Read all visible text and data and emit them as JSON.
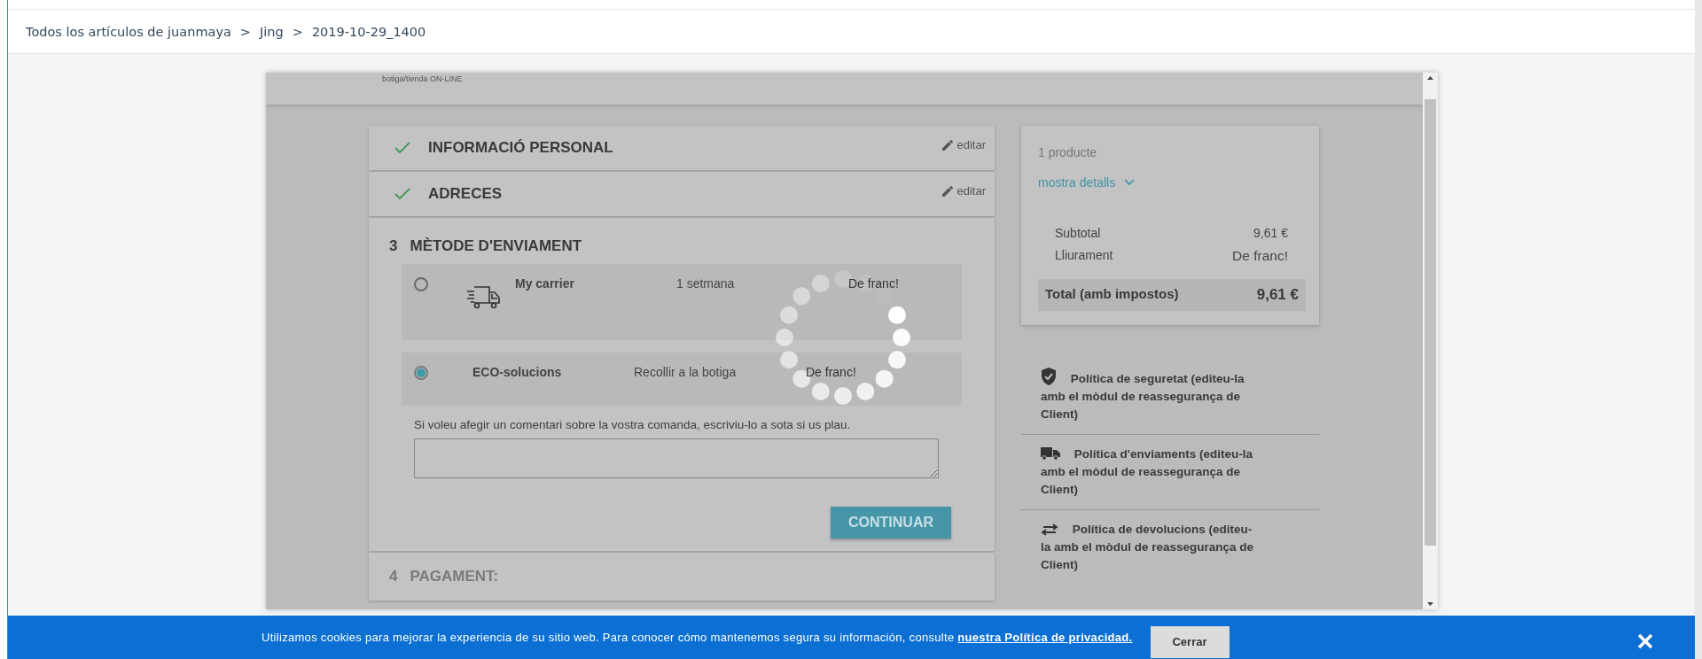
{
  "breadcrumb": [
    {
      "label": "Todos los artículos de juanmaya",
      "separator": ">"
    },
    {
      "label": "Jing",
      "separator": ">"
    },
    {
      "label": "2019-10-29_1400"
    }
  ],
  "shop_header": {
    "logo_tagline": "botiga/tienda ON-LINE"
  },
  "completed_steps": [
    {
      "title": "INFORMACIÓ PERSONAL",
      "edit": "editar"
    },
    {
      "title": "ADRECES",
      "edit": "editar"
    }
  ],
  "current_step": {
    "number": "3",
    "title": "MÈTODE D'ENVIAMENT",
    "carriers": [
      {
        "kind": "with-logo",
        "name": "My carrier",
        "delay": "1 setmana",
        "price": "De franc!",
        "selected": false
      },
      {
        "kind": "plain",
        "name": "ECO-solucions",
        "delay": "Recollir a la botiga",
        "price": "De franc!",
        "selected": true
      }
    ],
    "comment_label": "Si voleu afegir un comentari sobre la vostra comanda, escriviu-lo a sota si us plau.",
    "continue_button": "CONTINUAR"
  },
  "next_step": {
    "number": "4",
    "title": "PAGAMENT:"
  },
  "cart_summary": {
    "products": "1 producte",
    "details_link": "mostra detalls",
    "lines": [
      {
        "label": "Subtotal",
        "value": "9,61 €"
      },
      {
        "label": "Lliurament",
        "value": "De franc!"
      }
    ],
    "total_label": "Total (amb impostos)",
    "total_value": "9,61 €"
  },
  "reassurance": [
    {
      "kind": "security",
      "text": "Política de seguretat (editeu-la amb el mòdul de reassegurança de Client)"
    },
    {
      "kind": "shipping",
      "text": "Política d'enviaments (editeu-la amb el mòdul de reassegurança de Client)"
    },
    {
      "kind": "returns",
      "text": "Política de devolucions (editeu-la amb el mòdul de reassegurança de Client)"
    }
  ],
  "cookie_banner": {
    "text": "Utilizamos cookies para mejorar la experiencia de su sitio web. Para conocer cómo mantenemos segura su información, consulte ",
    "link": "nuestra Política de privacidad.",
    "button": "Cerrar"
  }
}
